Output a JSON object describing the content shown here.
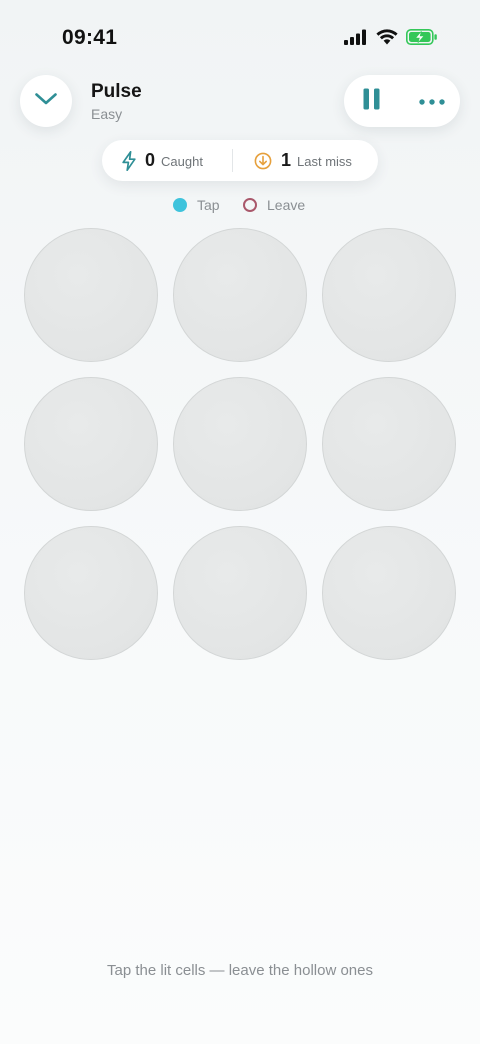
{
  "status_bar": {
    "time": "09:41",
    "icons": [
      "cellular-signal-icon",
      "wifi-icon",
      "battery-charging-icon"
    ],
    "battery_color": "#34c759"
  },
  "header": {
    "back_icon": "chevron-down-icon",
    "title": "Pulse",
    "difficulty": "Easy",
    "pause_icon": "pause-icon",
    "more_icon": "more-horizontal-icon",
    "accent_color": "#2f8f96"
  },
  "stats": {
    "caught": {
      "icon": "lightning-bolt-icon",
      "value": "0",
      "label": "Caught",
      "color": "#2f8f96"
    },
    "last_miss": {
      "icon": "down-arrow-circle-icon",
      "value": "1",
      "label": "Last miss",
      "color": "#e6a03c"
    }
  },
  "legend": {
    "tap": {
      "label": "Tap",
      "color": "#3ec3dc"
    },
    "leave": {
      "label": "Leave",
      "color": "#a9586b"
    }
  },
  "grid": {
    "rows": 3,
    "columns": 3,
    "cells": [
      {
        "state": "empty"
      },
      {
        "state": "empty"
      },
      {
        "state": "empty"
      },
      {
        "state": "empty"
      },
      {
        "state": "empty"
      },
      {
        "state": "empty"
      },
      {
        "state": "empty"
      },
      {
        "state": "empty"
      },
      {
        "state": "empty"
      }
    ]
  },
  "footer": {
    "hint": "Tap the lit cells — leave the hollow ones"
  }
}
